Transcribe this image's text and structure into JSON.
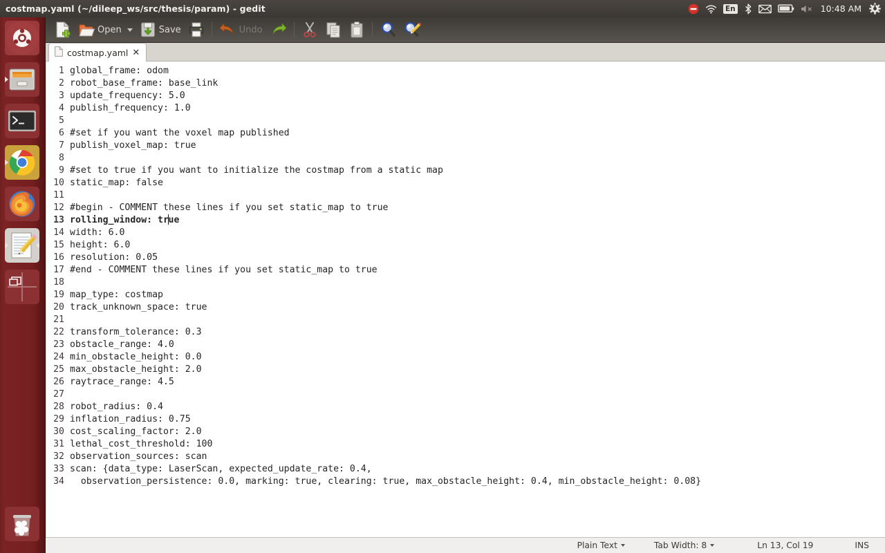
{
  "top_panel": {
    "window_title": "costmap.yaml (~/dileep_ws/src/thesis/param) - gedit",
    "tray": {
      "clock": "10:48 AM",
      "keyboard_layout": "En",
      "icons": [
        "do-not-disturb-icon",
        "wifi-icon",
        "keyboard-layout-indicator",
        "bluetooth-icon",
        "mail-icon",
        "battery-icon",
        "volume-muted-icon",
        "session-gear-icon"
      ]
    }
  },
  "launcher": {
    "items": [
      {
        "name": "ubuntu-dash",
        "label": "Ubuntu Dash",
        "running": false,
        "focused": false
      },
      {
        "name": "files",
        "label": "Files",
        "running": true,
        "focused": false
      },
      {
        "name": "terminal",
        "label": "Terminal",
        "running": false,
        "focused": false
      },
      {
        "name": "chrome",
        "label": "Google Chrome",
        "running": true,
        "focused": false
      },
      {
        "name": "firefox",
        "label": "Firefox",
        "running": false,
        "focused": false
      },
      {
        "name": "gedit",
        "label": "Text Editor",
        "running": true,
        "focused": true
      },
      {
        "name": "workspace-switcher",
        "label": "Workspace Switcher",
        "running": false,
        "focused": false
      },
      {
        "name": "trash",
        "label": "Trash",
        "running": false,
        "focused": false
      }
    ]
  },
  "toolbar": {
    "new_label": "",
    "open_label": "Open",
    "save_label": "Save",
    "print_label": "",
    "undo_label": "Undo",
    "undo_disabled": true,
    "redo_label": "",
    "cut_label": "",
    "copy_label": "",
    "paste_label": "",
    "find_label": "",
    "replace_label": ""
  },
  "tabs": [
    {
      "label": "costmap.yaml",
      "close": "✕",
      "active": true
    }
  ],
  "editor": {
    "current_line": 13,
    "cursor_column_index": 18,
    "lines": [
      {
        "n": "1",
        "text": "global_frame: odom"
      },
      {
        "n": "2",
        "text": "robot_base_frame: base_link"
      },
      {
        "n": "3",
        "text": "update_frequency: 5.0"
      },
      {
        "n": "4",
        "text": "publish_frequency: 1.0"
      },
      {
        "n": "5",
        "text": ""
      },
      {
        "n": "6",
        "text": "#set if you want the voxel map published"
      },
      {
        "n": "7",
        "text": "publish_voxel_map: true"
      },
      {
        "n": "8",
        "text": ""
      },
      {
        "n": "9",
        "text": "#set to true if you want to initialize the costmap from a static map"
      },
      {
        "n": "10",
        "text": "static_map: false"
      },
      {
        "n": "11",
        "text": ""
      },
      {
        "n": "12",
        "text": "#begin - COMMENT these lines if you set static_map to true"
      },
      {
        "n": "13",
        "text": "rolling_window: true"
      },
      {
        "n": "14",
        "text": "width: 6.0"
      },
      {
        "n": "15",
        "text": "height: 6.0"
      },
      {
        "n": "16",
        "text": "resolution: 0.05"
      },
      {
        "n": "17",
        "text": "#end - COMMENT these lines if you set static_map to true"
      },
      {
        "n": "18",
        "text": ""
      },
      {
        "n": "19",
        "text": "map_type: costmap"
      },
      {
        "n": "20",
        "text": "track_unknown_space: true"
      },
      {
        "n": "21",
        "text": ""
      },
      {
        "n": "22",
        "text": "transform_tolerance: 0.3"
      },
      {
        "n": "23",
        "text": "obstacle_range: 4.0"
      },
      {
        "n": "24",
        "text": "min_obstacle_height: 0.0"
      },
      {
        "n": "25",
        "text": "max_obstacle_height: 2.0"
      },
      {
        "n": "26",
        "text": "raytrace_range: 4.5"
      },
      {
        "n": "27",
        "text": ""
      },
      {
        "n": "28",
        "text": "robot_radius: 0.4"
      },
      {
        "n": "29",
        "text": "inflation_radius: 0.75"
      },
      {
        "n": "30",
        "text": "cost_scaling_factor: 2.0"
      },
      {
        "n": "31",
        "text": "lethal_cost_threshold: 100"
      },
      {
        "n": "32",
        "text": "observation_sources: scan"
      },
      {
        "n": "33",
        "text": "scan: {data_type: LaserScan, expected_update_rate: 0.4,"
      },
      {
        "n": "34",
        "text": "  observation_persistence: 0.0, marking: true, clearing: true, max_obstacle_height: 0.4, min_obstacle_height: 0.08}"
      }
    ]
  },
  "statusbar": {
    "language": "Plain Text",
    "tab_width": "Tab Width: 8",
    "position": "Ln 13, Col 19",
    "insert_mode": "INS"
  },
  "colors": {
    "panel": "#3b3834",
    "launcher": "#7b2324",
    "toolbar": "#4c4944",
    "editor_bg": "#ffffff",
    "statusbar_bg": "#f0efee",
    "text": "#252525"
  }
}
